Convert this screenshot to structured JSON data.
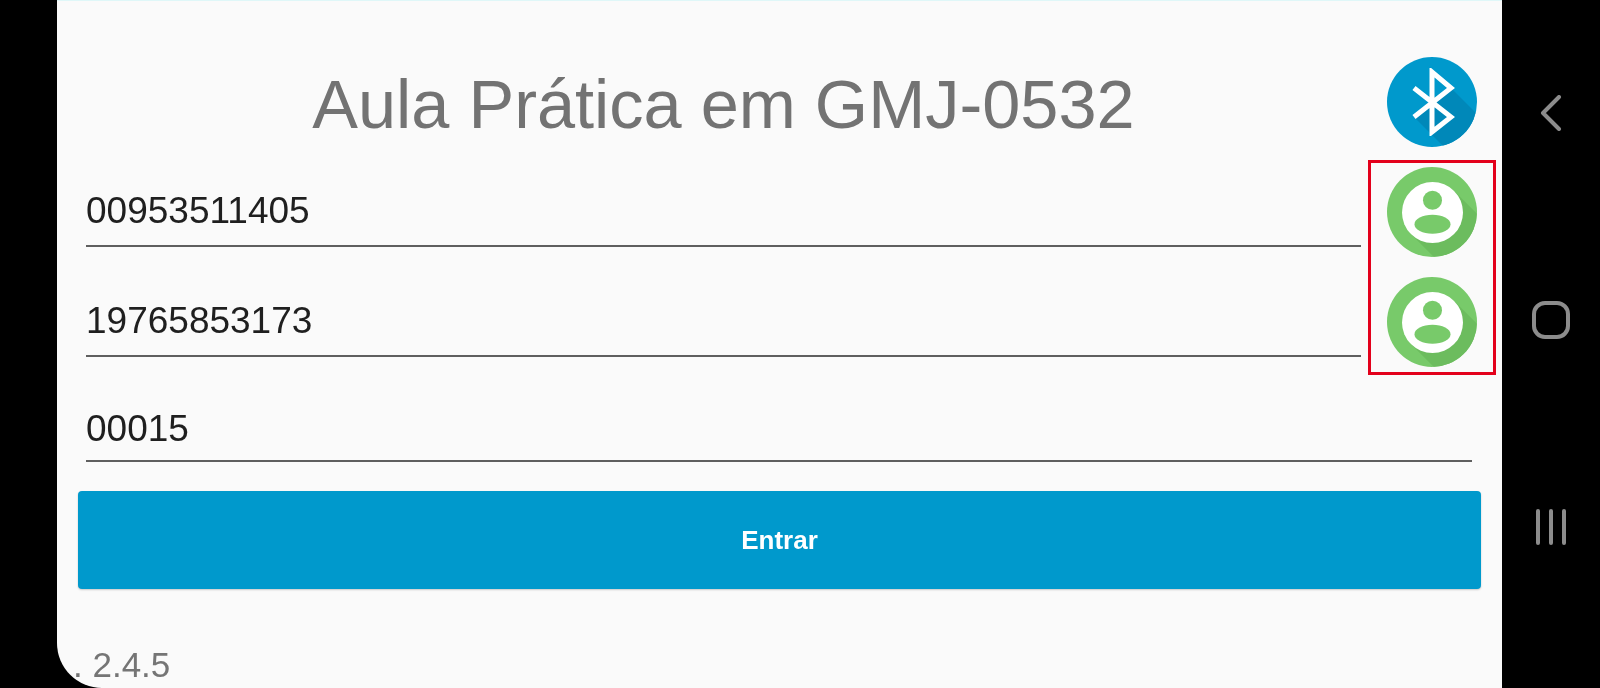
{
  "screen": {
    "title": "Aula Prática em GMJ-0532",
    "header_button": {
      "kind": "bluetooth"
    },
    "fields": [
      {
        "kind": "with_contact",
        "value": "00953511405"
      },
      {
        "kind": "with_contact",
        "value": "19765853173"
      },
      {
        "kind": "plain",
        "value": "00015"
      }
    ],
    "contact_buttons_highlighted": true,
    "submit_button": {
      "label": "Entrar"
    },
    "version": ". 2.4.5"
  },
  "nav_bar": {
    "buttons": [
      {
        "kind": "back"
      },
      {
        "kind": "home"
      },
      {
        "kind": "recents"
      }
    ]
  }
}
